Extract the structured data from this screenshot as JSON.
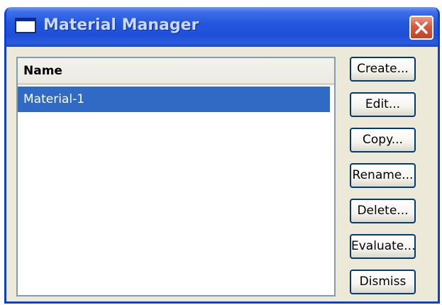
{
  "window": {
    "title": "Material Manager"
  },
  "list": {
    "column_header": "Name",
    "items": [
      {
        "label": "Material-1",
        "selected": true
      }
    ]
  },
  "buttons": {
    "create": "Create...",
    "edit": "Edit...",
    "copy": "Copy...",
    "rename": "Rename...",
    "delete": "Delete...",
    "evaluate": "Evaluate...",
    "dismiss": "Dismiss"
  },
  "icons": {
    "window_icon": "window-icon",
    "close_icon": "close-icon"
  },
  "colors": {
    "titlebar": "#2457dd",
    "selection": "#316ac5",
    "close_button": "#d4593f",
    "dialog_background": "#ece9d8"
  }
}
